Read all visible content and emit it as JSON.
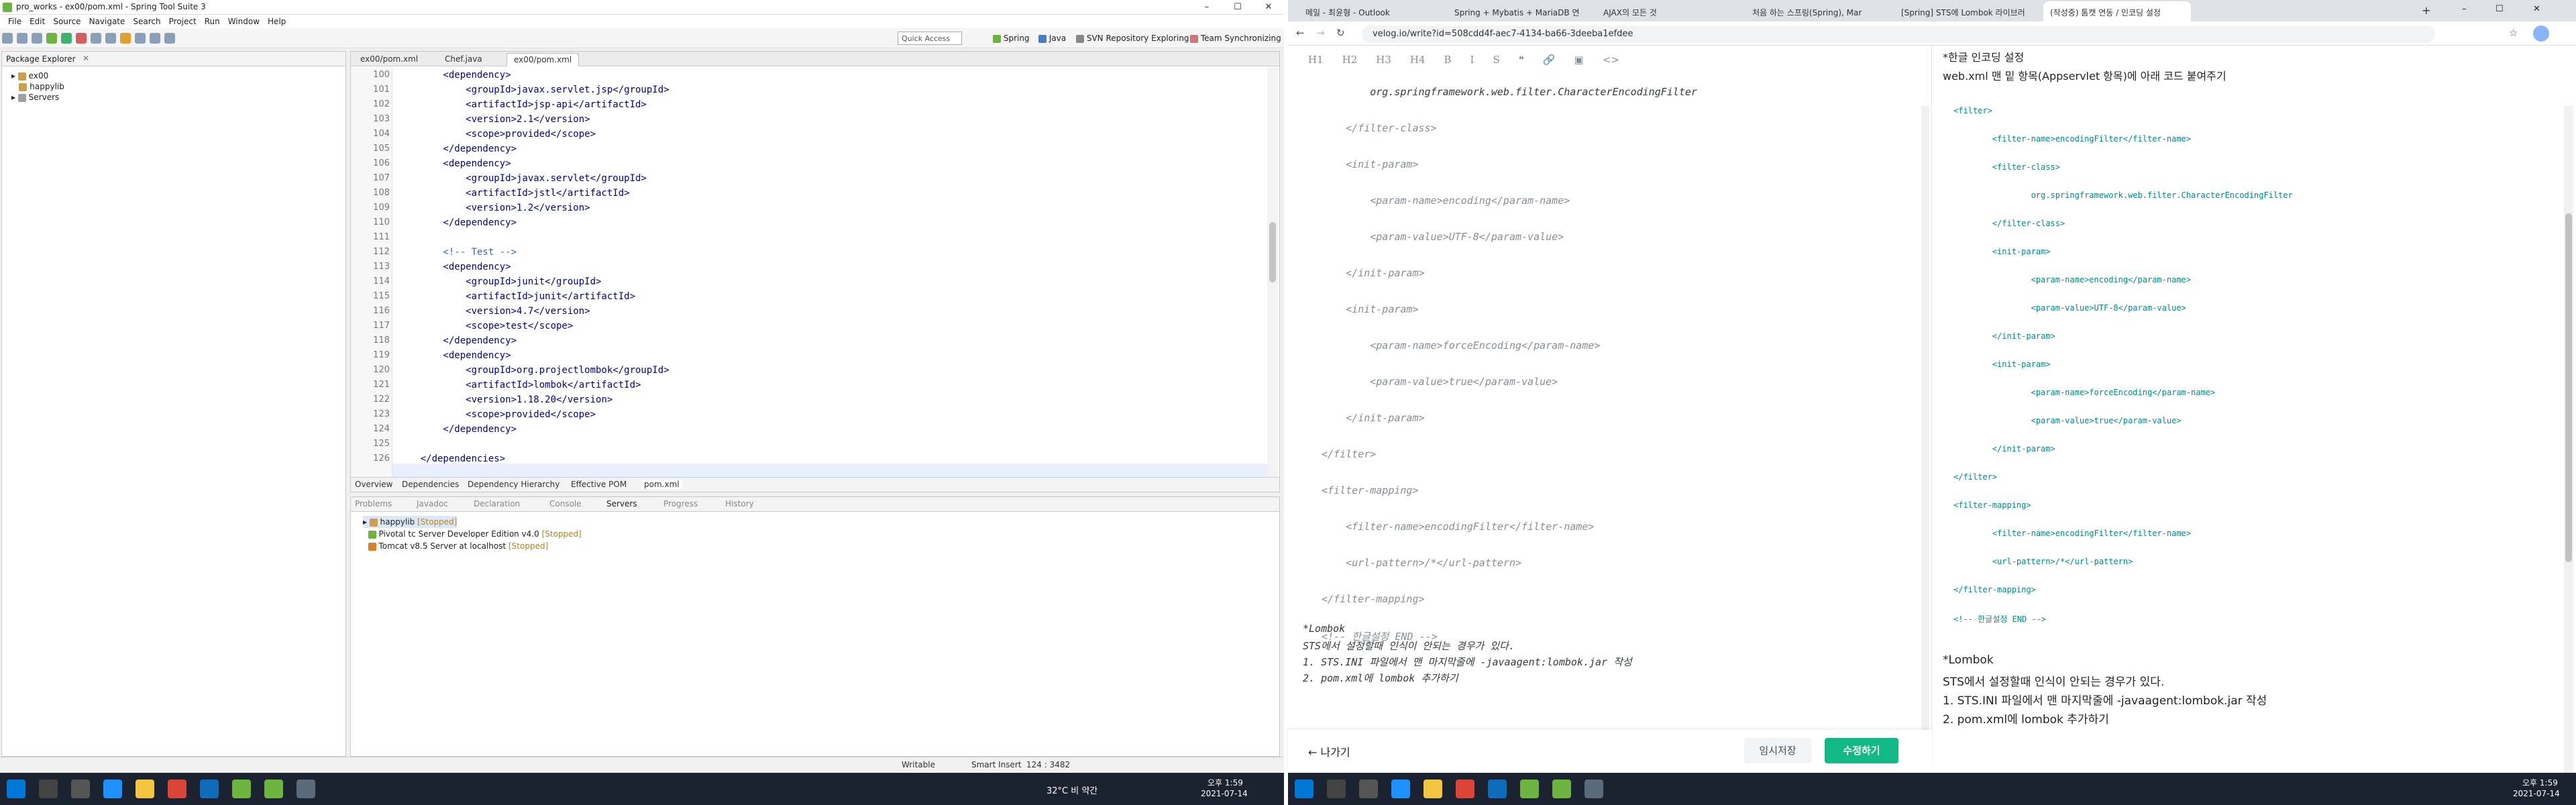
{
  "eclipse": {
    "title": "pro_works - ex00/pom.xml - Spring Tool Suite 3",
    "menu": [
      "File",
      "Edit",
      "Source",
      "Navigate",
      "Search",
      "Project",
      "Run",
      "Window",
      "Help"
    ],
    "quick_access": "Quick Access",
    "perspectives": [
      "Spring",
      "Java",
      "SVN Repository Exploring",
      "Team Synchronizing"
    ],
    "package_explorer": {
      "tab": "Package Explorer",
      "items": [
        "ex00",
        "happylib",
        "Servers"
      ]
    },
    "editor_tabs": [
      "ex00/pom.xml",
      "Chef.java",
      "ex00/pom.xml"
    ],
    "code_lines": [
      {
        "n": "100",
        "t": "        <dependency>"
      },
      {
        "n": "101",
        "t": "            <groupId>javax.servlet.jsp</groupId>"
      },
      {
        "n": "102",
        "t": "            <artifactId>jsp-api</artifactId>"
      },
      {
        "n": "103",
        "t": "            <version>2.1</version>"
      },
      {
        "n": "104",
        "t": "            <scope>provided</scope>"
      },
      {
        "n": "105",
        "t": "        </dependency>"
      },
      {
        "n": "106",
        "t": "        <dependency>"
      },
      {
        "n": "107",
        "t": "            <groupId>javax.servlet</groupId>"
      },
      {
        "n": "108",
        "t": "            <artifactId>jstl</artifactId>"
      },
      {
        "n": "109",
        "t": "            <version>1.2</version>"
      },
      {
        "n": "110",
        "t": "        </dependency>"
      },
      {
        "n": "111",
        "t": ""
      },
      {
        "n": "112",
        "t": "        <!-- Test -->"
      },
      {
        "n": "113",
        "t": "        <dependency>"
      },
      {
        "n": "114",
        "t": "            <groupId>junit</groupId>"
      },
      {
        "n": "115",
        "t": "            <artifactId>junit</artifactId>"
      },
      {
        "n": "116",
        "t": "            <version>4.7</version>"
      },
      {
        "n": "117",
        "t": "            <scope>test</scope>"
      },
      {
        "n": "118",
        "t": "        </dependency>"
      },
      {
        "n": "119",
        "t": "        <dependency>"
      },
      {
        "n": "120",
        "t": "            <groupId>org.projectlombok</groupId>"
      },
      {
        "n": "121",
        "t": "            <artifactId>lombok</artifactId>"
      },
      {
        "n": "122",
        "t": "            <version>1.18.20</version>"
      },
      {
        "n": "123",
        "t": "            <scope>provided</scope>"
      },
      {
        "n": "124",
        "t": "        </dependency>"
      },
      {
        "n": "125",
        "t": ""
      },
      {
        "n": "126",
        "t": "    </dependencies>"
      }
    ],
    "editor_bottom_tabs": [
      "Overview",
      "Dependencies",
      "Dependency Hierarchy",
      "Effective POM",
      "pom.xml"
    ],
    "servers_tabs": [
      "Problems",
      "Javadoc",
      "Declaration",
      "Console",
      "Servers",
      "Progress",
      "History"
    ],
    "servers": [
      {
        "name": "happylib",
        "status": "[Stopped]"
      },
      {
        "name": "Pivotal tc Server Developer Edition v4.0",
        "status": "[Stopped]"
      },
      {
        "name": "Tomcat v8.5 Server at localhost",
        "status": "[Stopped]"
      }
    ],
    "status_bar": [
      "Writable",
      "Smart Insert",
      "124 : 3482"
    ]
  },
  "taskbar_left": {
    "weather": "32°C 비 약간",
    "time": "오후 1:59",
    "date": "2021-07-14"
  },
  "taskbar_right": {
    "time": "오후 1:59",
    "date": "2021-07-14"
  },
  "browser": {
    "tabs": [
      "메일 - 최윤형 - Outlook",
      "Spring + Mybatis + MariaDB 연",
      "AJAX의 모든 것",
      "처음 하는 스프링(Spring), Mar",
      "[Spring] STS에 Lombok 라이브러",
      "(작성중) 톰캣 연동 / 인코딩 설정"
    ],
    "url": "velog.io/write?id=508cdd4f-aec7-4134-ba66-3deeba1efdee",
    "toolbar": [
      "H1",
      "H2",
      "H3",
      "H4",
      "B",
      "I",
      "S",
      "❝",
      "🔗",
      "▣",
      "<>"
    ],
    "editor_lines": [
      {
        "t": "        org.springframework.web.filter.CharacterEncodingFilter",
        "k": true
      },
      {
        "t": "    </filter-class>",
        "k": false
      },
      {
        "t": "    <init-param>",
        "k": false
      },
      {
        "t": "        <param-name>encoding</param-name>",
        "k": false
      },
      {
        "t": "        <param-value>UTF-8</param-value>",
        "k": false
      },
      {
        "t": "    </init-param>",
        "k": false
      },
      {
        "t": "    <init-param>",
        "k": false
      },
      {
        "t": "        <param-name>forceEncoding</param-name>",
        "k": false
      },
      {
        "t": "        <param-value>true</param-value>",
        "k": false
      },
      {
        "t": "    </init-param>",
        "k": false
      },
      {
        "t": "</filter>",
        "k": false
      },
      {
        "t": "<filter-mapping>",
        "k": false
      },
      {
        "t": "    <filter-name>encodingFilter</filter-name>",
        "k": false
      },
      {
        "t": "    <url-pattern>/*</url-pattern>",
        "k": false
      },
      {
        "t": "</filter-mapping>",
        "k": false
      },
      {
        "t": "<!-- 한글설정 END -->",
        "k": false
      }
    ],
    "editor_notes": [
      "*Lombok",
      "STS에서 설정할때 인식이 안되는 경우가 있다.",
      "1. STS.INI 파일에서 맨 마지막줄에 -javaagent:lombok.jar 작성",
      "2. pom.xml에 lombok 추가하기"
    ],
    "exit_label": "← 나가기",
    "save_draft_label": "임시저장",
    "publish_label": "수정하기",
    "preview": {
      "heading": "*한글 인코딩 설정",
      "sub": "web.xml 맨 밑 항목(Appservlet 항목)에 아래 코드 붙여주기",
      "code": [
        "<filter>",
        "        <filter-name>encodingFilter</filter-name>",
        "        <filter-class>",
        "                org.springframework.web.filter.CharacterEncodingFilter",
        "        </filter-class>",
        "        <init-param>",
        "                <param-name>encoding</param-name>",
        "                <param-value>UTF-8</param-value>",
        "        </init-param>",
        "        <init-param>",
        "                <param-name>forceEncoding</param-name>",
        "                <param-value>true</param-value>",
        "        </init-param>",
        "</filter>",
        "<filter-mapping>",
        "        <filter-name>encodingFilter</filter-name>",
        "        <url-pattern>/*</url-pattern>",
        "</filter-mapping>",
        "<!-- 한글설정 END -->"
      ],
      "notes": [
        "*Lombok",
        "STS에서 설정할때 인식이 안되는 경우가 있다.",
        "1. STS.INI 파일에서 맨 마지막줄에 -javaagent:lombok.jar 작성",
        "2. pom.xml에 lombok 추가하기"
      ]
    }
  }
}
